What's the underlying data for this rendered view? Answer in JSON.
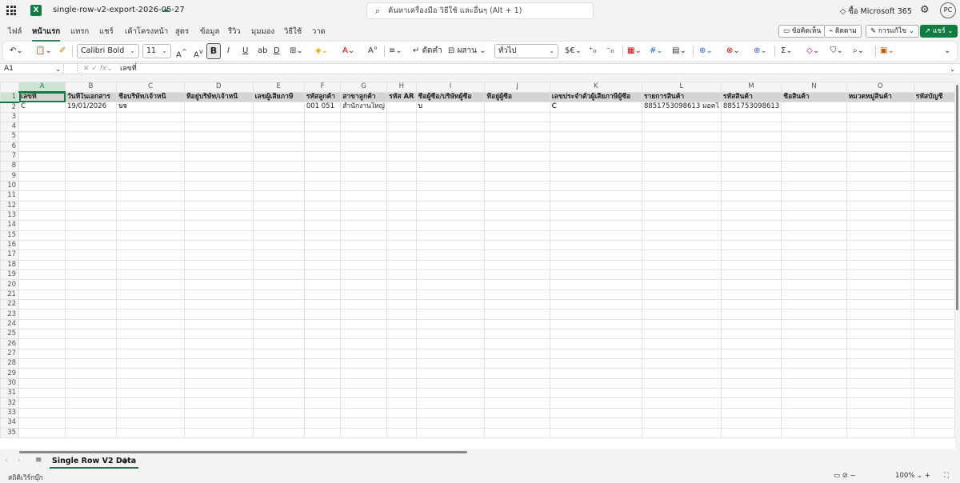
{
  "app": {
    "doc_title": "single-row-v2-export-2026-05-27",
    "search_placeholder": "ค้นหาเครื่องมือ วิธีใช้ และอื่นๆ (Alt + 1)",
    "buy_label": "ซื้อ Microsoft 365",
    "avatar": "PC",
    "brand_color": "#107c41"
  },
  "ribbon": {
    "tabs": [
      "ไฟล์",
      "หน้าแรก",
      "แทรก",
      "แชร์",
      "เค้าโครงหน้า",
      "สูตร",
      "ข้อมูล",
      "รีวิว",
      "มุมมอง",
      "วิธีใช้",
      "วาด"
    ],
    "active_tab": "หน้าแรก",
    "comments": "ข้อคิดเห็น",
    "catchup": "ติดตาม",
    "editing": "การแก้ไข",
    "share": "แชร์"
  },
  "toolbar": {
    "font_name": "Calibri Bold",
    "font_size": "11",
    "wrap": "ตัดคำ",
    "merge": "ผสาน",
    "number_format": "ทั่วไป",
    "currency": "$€"
  },
  "formula_bar": {
    "name_box": "A1",
    "fx": "fx",
    "formula": "เลขที่"
  },
  "grid": {
    "columns": [
      "A",
      "B",
      "C",
      "D",
      "E",
      "F",
      "G",
      "H",
      "I",
      "J",
      "K",
      "L",
      "M",
      "N",
      "O",
      ""
    ],
    "header_row": [
      "เลขที่",
      "วันที่ในเอกสาร",
      "ชื่อบริษัท/เจ้าหนี้",
      "ที่อยู่บริษัท/เจ้าหนี้",
      "เลขผู้เสียภาษี",
      "รหัสลูกค้า",
      "สาขาลูกค้า",
      "รหัส AR",
      "ชื่อผู้ซื้อ/บริษัทผู้ซื้อ",
      "ที่อยู่ผู้ซื้อ",
      "เลขประจำตัวผู้เสียภาษีผู้ซื้อ",
      "รายการสินค้า",
      "รหัสสินค้า",
      "ชื่อสินค้า",
      "หมวดหมู่สินค้า",
      "รหัสบัญชี"
    ],
    "data_row": [
      "C",
      "19/01/2026",
      "บจ",
      "",
      "",
      "001 051",
      "สำนักงานใหญ่",
      "",
      "บ",
      "",
      "C",
      "8851753098613 มอคโ",
      "8851753098613",
      "",
      "",
      ""
    ],
    "row_count": 35
  },
  "sheets": {
    "active": "Single Row V2 Data"
  },
  "status": {
    "left": "สถิติเวิร์กบุ๊ก",
    "zoom": "100%"
  }
}
